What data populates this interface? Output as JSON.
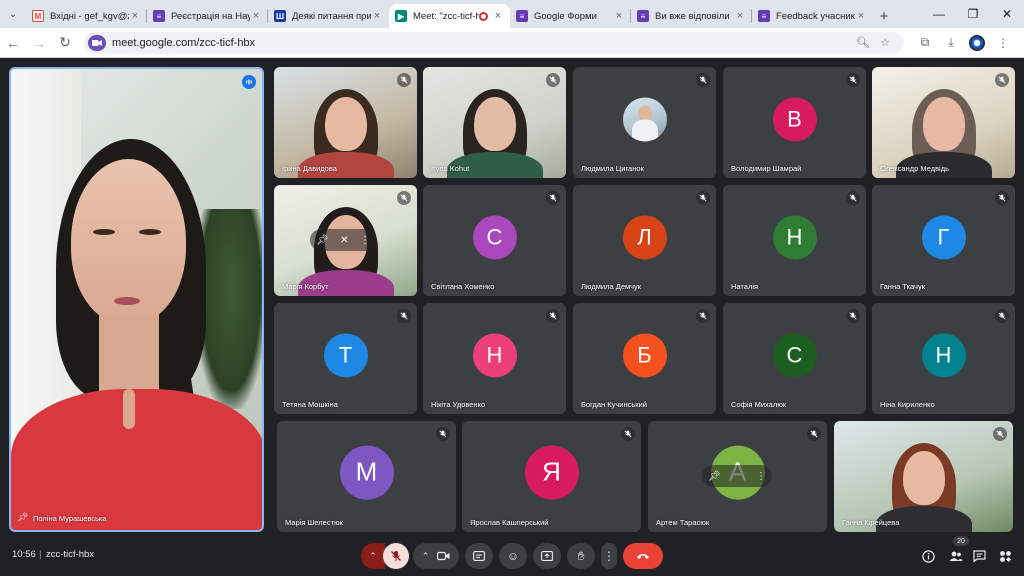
{
  "browser": {
    "tabs": [
      {
        "label": "Вхідні - gef_kgv@ztu",
        "favicon": "gmail-icon",
        "active": false
      },
      {
        "label": "Реєстрація на Науко",
        "favicon": "google-forms-icon",
        "active": false
      },
      {
        "label": "Деякі питання прис",
        "favicon": "doc-icon",
        "active": false
      },
      {
        "label": "Meet: \"zcc-ticf-h",
        "favicon": "google-meet-icon",
        "active": true
      },
      {
        "label": "Google Форми",
        "favicon": "google-forms-icon",
        "active": false
      },
      {
        "label": "Ви вже відповіли",
        "favicon": "google-forms-icon",
        "active": false
      },
      {
        "label": "Feedback учасників",
        "favicon": "google-forms-icon",
        "active": false
      }
    ],
    "url": "meet.google.com/zcc-ticf-hbx"
  },
  "meet": {
    "featured": {
      "name": "Поліна Мурашевська"
    },
    "grid": [
      {
        "name": "Ірина Давидова",
        "kind": "video"
      },
      {
        "name": "Iryna Kohut",
        "kind": "video"
      },
      {
        "name": "Людмила Циганок",
        "kind": "photo"
      },
      {
        "name": "Володимир Шамрай",
        "kind": "letter",
        "letter": "В",
        "color": "#d81b60"
      },
      {
        "name": "Олександр Медвідь",
        "kind": "video"
      },
      {
        "name": "Марія Корбут",
        "kind": "video"
      },
      {
        "name": "Світлана Хоменко",
        "kind": "letter",
        "letter": "С",
        "color": "#ab47bc"
      },
      {
        "name": "Людмила Демчук",
        "kind": "letter",
        "letter": "Л",
        "color": "#d84315"
      },
      {
        "name": "Наталія",
        "kind": "letter",
        "letter": "Н",
        "color": "#2e7d32"
      },
      {
        "name": "Ганна Ткачук",
        "kind": "letter",
        "letter": "Г",
        "color": "#1e88e5"
      },
      {
        "name": "Тетяна Мошкіна",
        "kind": "letter",
        "letter": "Т",
        "color": "#1e88e5"
      },
      {
        "name": "Нікіта Удовенко",
        "kind": "letter",
        "letter": "Н",
        "color": "#ec407a"
      },
      {
        "name": "Богдан Кучинський",
        "kind": "letter",
        "letter": "Б",
        "color": "#f4511e"
      },
      {
        "name": "Софія Михалюк",
        "kind": "letter",
        "letter": "С",
        "color": "#1b5e20"
      },
      {
        "name": "Ніна Кириленко",
        "kind": "letter",
        "letter": "Н",
        "color": "#00838f"
      }
    ],
    "bottom_row": [
      {
        "name": "Марія Шелестюк",
        "kind": "letter",
        "letter": "М",
        "color": "#7e57c2"
      },
      {
        "name": "Ярослав Кашперський",
        "kind": "letter",
        "letter": "Я",
        "color": "#d81b60"
      },
      {
        "name": "Артем Тарасюк",
        "kind": "letter",
        "letter": "А",
        "color": "#7cb342"
      },
      {
        "name": "Ганна Кірейцева",
        "kind": "video"
      }
    ],
    "time": "10:56",
    "meeting_code": "zcc-ticf-hbx",
    "people_count": "20"
  }
}
